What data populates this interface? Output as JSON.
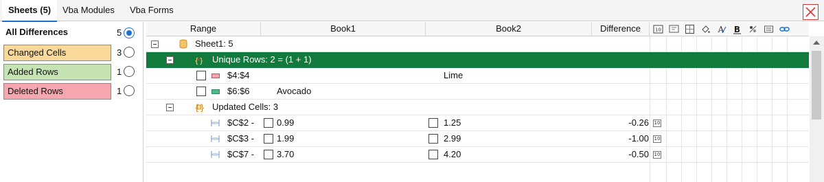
{
  "tabs": [
    {
      "label": "Sheets (5)",
      "active": true
    },
    {
      "label": "Vba Modules",
      "active": false
    },
    {
      "label": "Vba Forms",
      "active": false
    }
  ],
  "filters": [
    {
      "label": "All Differences",
      "count": "5",
      "selected": true,
      "color": "#ffffff"
    },
    {
      "label": "Changed Cells",
      "count": "3",
      "selected": false,
      "color": "#f8d99a"
    },
    {
      "label": "Added Rows",
      "count": "1",
      "selected": false,
      "color": "#c6e3b4"
    },
    {
      "label": "Deleted Rows",
      "count": "1",
      "selected": false,
      "color": "#f6a6ae"
    }
  ],
  "columns": {
    "range": "Range",
    "book1": "Book1",
    "book2": "Book2",
    "difference": "Difference"
  },
  "tree": {
    "sheet": "Sheet1: 5",
    "unique_group": "Unique Rows: 2 = (1 + 1)",
    "unique_rows": [
      {
        "range": "$4:$4",
        "book1": "",
        "book2": "Lime",
        "swatch": "#f6a6ae"
      },
      {
        "range": "$6:$6",
        "book1": "Avocado",
        "book2": "",
        "swatch": "#55b489"
      }
    ],
    "updated_group": "Updated Cells: 3",
    "updated_cells": [
      {
        "range": "$C$2 -",
        "book1": "0.99",
        "book2": "1.25",
        "difference": "-0.26"
      },
      {
        "range": "$C$3 -",
        "book1": "1.99",
        "book2": "2.99",
        "difference": "-1.00"
      },
      {
        "range": "$C$7 -",
        "book1": "3.70",
        "book2": "4.20",
        "difference": "-0.50"
      }
    ]
  },
  "toolbar_icons": [
    "number-format-icon",
    "comment-icon",
    "border-icon",
    "fill-color-icon",
    "font-color-icon",
    "bold-icon",
    "formula-icon",
    "align-icon",
    "link-icon"
  ],
  "colors": {
    "accent": "#1e6fd0",
    "unique_rows_bg": "#127a3c",
    "close": "#d23b3b"
  }
}
